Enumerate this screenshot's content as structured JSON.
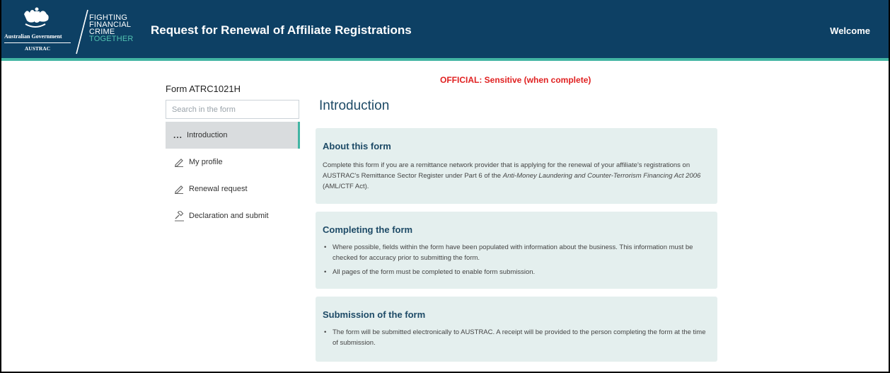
{
  "header": {
    "gov_name": "Australian Government",
    "agency": "AUSTRAC",
    "slogan": [
      "FIGHTING",
      "FINANCIAL",
      "CRIME",
      "TOGETHER"
    ],
    "title": "Request for Renewal of Affiliate Registrations",
    "welcome": "Welcome"
  },
  "classification": "OFFICIAL: Sensitive (when complete)",
  "sidebar": {
    "form_id": "Form ATRC1021H",
    "search_placeholder": "Search in the form",
    "items": [
      {
        "label": "Introduction",
        "icon": "ellipsis-icon",
        "active": true
      },
      {
        "label": "My profile",
        "icon": "pencil-icon",
        "active": false
      },
      {
        "label": "Renewal request",
        "icon": "pencil-icon",
        "active": false
      },
      {
        "label": "Declaration and submit",
        "icon": "gavel-icon",
        "active": false
      }
    ]
  },
  "main": {
    "title": "Introduction",
    "sections": [
      {
        "heading": "About this form",
        "text_before": "Complete this form if you are a remittance network provider that is applying for the renewal of your affiliate's registrations on AUSTRAC's Remittance Sector Register under Part 6 of the ",
        "text_italic": "Anti-Money Laundering and Counter-Terrorism Financing Act 2006",
        "text_after": " (AML/CTF Act)."
      },
      {
        "heading": "Completing the form",
        "bullets": [
          "Where possible, fields within the form have been populated with information about the business. This information must be checked for accuracy prior to submitting the form.",
          "All pages of the form must be completed to enable form submission."
        ]
      },
      {
        "heading": "Submission of the form",
        "bullets": [
          "The form will be submitted electronically to AUSTRAC. A receipt will be provided to the person completing the form at the time of submission."
        ]
      }
    ]
  },
  "colors": {
    "header_bg": "#0d4064",
    "accent": "#42b5a3",
    "classification": "#e02020",
    "card_bg": "#e4efee",
    "heading": "#1d4a66"
  }
}
